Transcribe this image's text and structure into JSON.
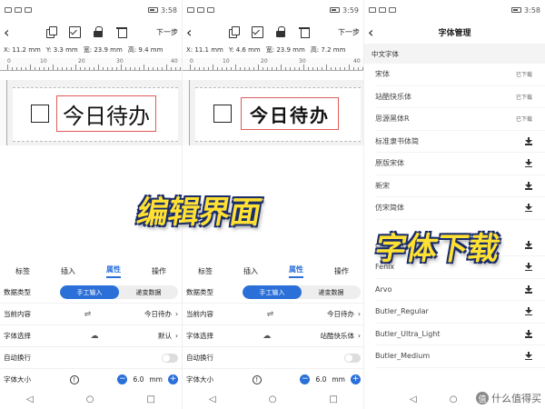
{
  "screens": [
    {
      "status_time": "3:58",
      "toolbar": {
        "next_label": "下一步"
      },
      "coords": [
        "X: 11.2 mm",
        "Y: 3.3 mm",
        "宽: 23.9 mm",
        "高: 9.4 mm"
      ],
      "ruler_labels": [
        "0",
        "10",
        "20",
        "30",
        "40"
      ],
      "label_text": "今日待办",
      "tabs": [
        "标签",
        "插入",
        "属性",
        "操作"
      ],
      "panel": {
        "data_type_label": "数据类型",
        "seg_on": "手工输入",
        "seg_off": "递变数据",
        "content_label": "当前内容",
        "content_value": "今日待办",
        "font_label": "字体选择",
        "font_value": "默认",
        "wrap_label": "自动换行",
        "size_label": "字体大小",
        "size_value": "6.0",
        "size_unit": "mm"
      }
    },
    {
      "status_time": "3:59",
      "toolbar": {
        "next_label": "下一步"
      },
      "coords": [
        "X: 11.1 mm",
        "Y: 4.6 mm",
        "宽: 23.9 mm",
        "高: 7.2 mm"
      ],
      "ruler_labels": [
        "0",
        "10",
        "20",
        "30",
        "40"
      ],
      "label_text": "今日待办",
      "tabs": [
        "标签",
        "插入",
        "属性",
        "操作"
      ],
      "panel": {
        "data_type_label": "数据类型",
        "seg_on": "手工输入",
        "seg_off": "递变数据",
        "content_label": "当前内容",
        "content_value": "今日待办",
        "font_label": "字体选择",
        "font_value": "站酷快乐体",
        "wrap_label": "自动换行",
        "size_label": "字体大小",
        "size_value": "6.0",
        "size_unit": "mm"
      }
    }
  ],
  "font_screen": {
    "status_time": "3:58",
    "title": "字体管理",
    "section": "中文字体",
    "fonts": [
      {
        "name": "宋体",
        "status": "已下载"
      },
      {
        "name": "站酷快乐体",
        "status": "已下载"
      },
      {
        "name": "思源黑体R",
        "status": "已下载"
      },
      {
        "name": "标准隶书体简",
        "status": ""
      },
      {
        "name": "原版宋体",
        "status": ""
      },
      {
        "name": "新宋",
        "status": ""
      },
      {
        "name": "仿宋简体",
        "status": ""
      }
    ],
    "fonts_en": [
      "crimson",
      "Fenix",
      "Arvo",
      "Butler_Regular",
      "Butler_Ultra_Light",
      "Butler_Medium"
    ]
  },
  "overlays": {
    "edit": "编辑界面",
    "download": "字体下载"
  },
  "watermark": "什么值得买",
  "watermark_icon": "值",
  "nav": {
    "back": "◁",
    "home": "○",
    "recent": "□"
  },
  "icons": {
    "back": "‹",
    "chevron": "›",
    "info": "!",
    "minus": "−",
    "plus": "+",
    "cloud": "☁",
    "swap": "⇌"
  }
}
